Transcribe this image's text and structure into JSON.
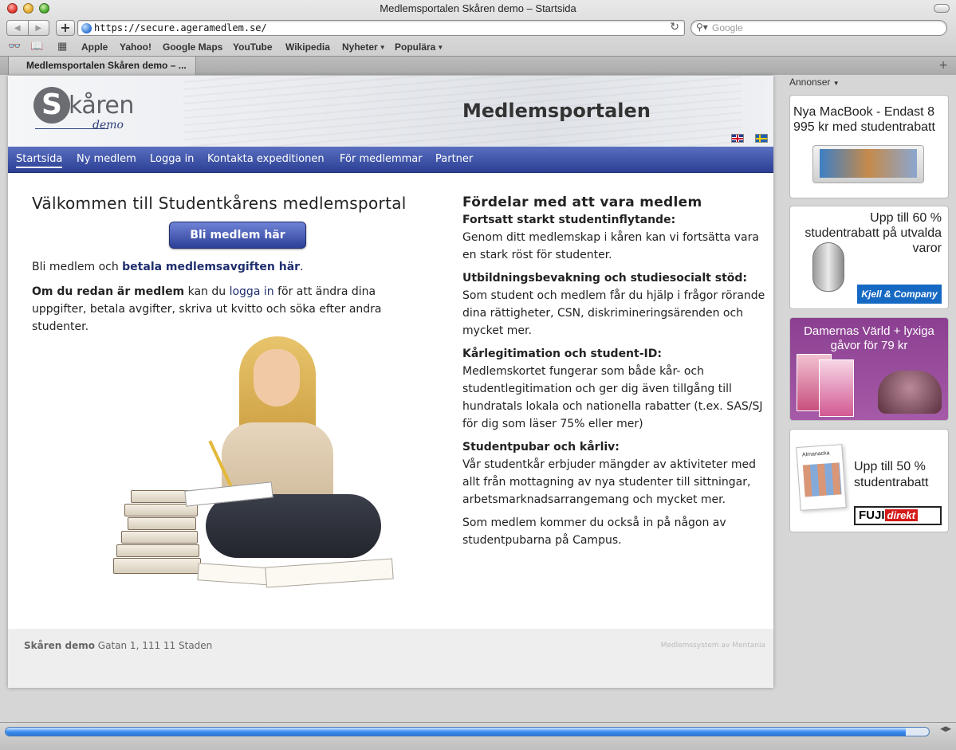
{
  "window": {
    "title": "Medlemsportalen Skåren demo – Startsida"
  },
  "toolbar": {
    "back_icon": "back-arrow-icon",
    "forward_icon": "forward-arrow-icon",
    "add_label": "+",
    "url": "https://secure.ageramedlem.se/",
    "search_placeholder": "Google"
  },
  "bookmarks": {
    "items": [
      {
        "label": "Apple"
      },
      {
        "label": "Yahoo!"
      },
      {
        "label": "Google Maps"
      },
      {
        "label": "YouTube"
      },
      {
        "label": "Wikipedia"
      },
      {
        "label": "Nyheter",
        "menu": true
      },
      {
        "label": "Populära",
        "menu": true
      }
    ]
  },
  "tab": {
    "label": "Medlemsportalen Skåren demo – ..."
  },
  "site": {
    "logo_word": "kåren",
    "logo_letter": "S",
    "logo_sub": "demo",
    "portal_title": "Medlemsportalen",
    "nav": [
      {
        "label": "Startsida",
        "active": true
      },
      {
        "label": "Ny medlem"
      },
      {
        "label": "Logga in"
      },
      {
        "label": "Kontakta expeditionen"
      },
      {
        "label": "För medlemmar"
      },
      {
        "label": "Partner"
      }
    ]
  },
  "welcome": {
    "heading": "Välkommen till Studentkårens medlemsportal",
    "join_button": "Bli medlem här",
    "p1_prefix": "Bli medlem och ",
    "p1_link": "betala medlemsavgiften här",
    "p1_suffix": ".",
    "p2_bold": "Om du redan är medlem",
    "p2_mid": " kan du ",
    "p2_link": "logga in",
    "p2_rest": " för att ändra dina uppgifter, betala avgifter, skriva ut kvitto och söka efter andra studenter."
  },
  "benefits": {
    "heading": "Fördelar med att vara medlem",
    "sections": [
      {
        "title": "Fortsatt starkt studentinflytande:",
        "text": "Genom ditt medlemskap i kåren kan vi fortsätta vara en stark röst för studenter."
      },
      {
        "title": "Utbildningsbevakning och studiesocialt stöd:",
        "text": "Som student och medlem får du hjälp i frågor rörande dina rättigheter, CSN, diskrimineringsärenden och mycket mer."
      },
      {
        "title": "Kårlegitimation och student-ID:",
        "text": "Medlemskortet fungerar som både kår- och studentlegitimation och ger dig även tillgång till hundratals lokala och nationella rabatter (t.ex. SAS/SJ för dig som läser 75% eller mer)"
      },
      {
        "title": "Studentpubar och kårliv:",
        "text": "Vår studentkår erbjuder mängder av aktiviteter med allt från mottagning av nya studenter till sittningar, arbetsmarknadsarrangemang och mycket mer."
      },
      {
        "title": "",
        "text": "Som medlem kommer du också in på någon av studentpubarna på Campus."
      }
    ]
  },
  "footer": {
    "org": "Skåren demo",
    "address": " Gatan 1, 111 11 Staden",
    "credit": "Medlemssystem av Mentania"
  },
  "ads": {
    "label": "Annonser",
    "items": [
      {
        "text": "Nya MacBook - Endast 8 995 kr med studentrabatt"
      },
      {
        "text": "Upp till 60 % studentrabatt på utvalda varor",
        "brand": "Kjell & Company"
      },
      {
        "text": "Damernas Värld + lyxiga gåvor för 79 kr"
      },
      {
        "text": "Upp till 50 % studentrabatt",
        "brand_main": "FUJI",
        "brand_accent": "direkt",
        "calendar_label": "Almanacka"
      }
    ]
  },
  "status": {
    "progress": 0.975
  },
  "colors": {
    "nav_top": "#5a6fc0",
    "nav_bottom": "#2b3f94",
    "link": "#1f2f6e",
    "button": "#3c4fa8"
  }
}
